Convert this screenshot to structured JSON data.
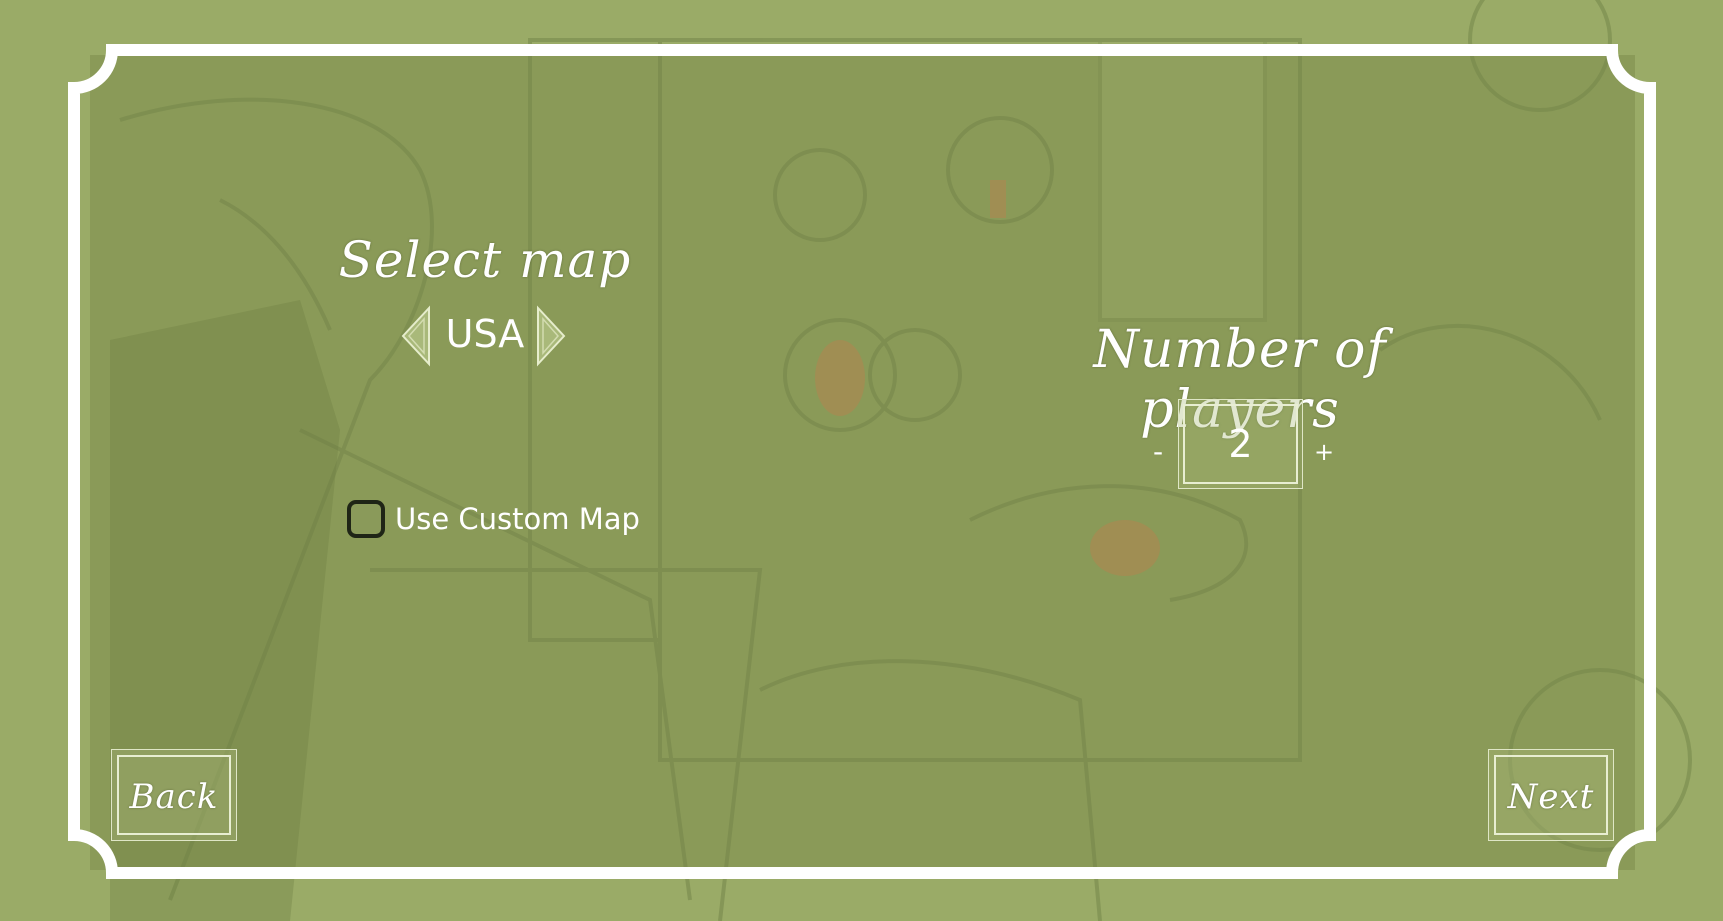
{
  "screen": {
    "background_color": "#8f9f5e",
    "frame_color": "#ffffff"
  },
  "map_section": {
    "title": "Select map",
    "selected_map": "USA",
    "prev_icon": "triangle-left-icon",
    "next_icon": "triangle-right-icon",
    "custom_map_label": "Use Custom Map",
    "custom_map_checked": false
  },
  "players_section": {
    "title": "Number of players",
    "count": "2",
    "decrement_label": "-",
    "increment_label": "+"
  },
  "navigation": {
    "back_label": "Back",
    "next_label": "Next"
  }
}
